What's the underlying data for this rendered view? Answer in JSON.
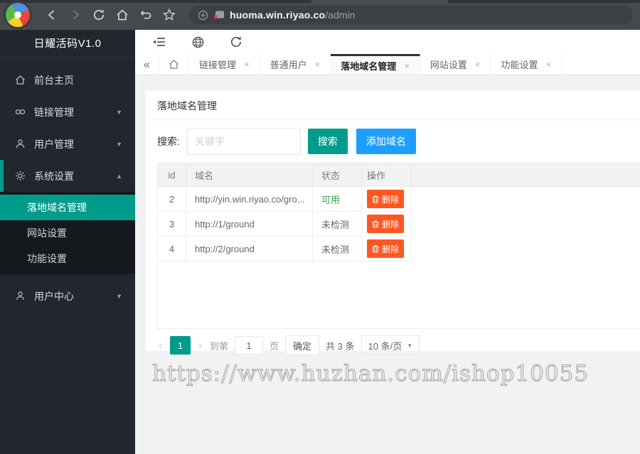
{
  "browser": {
    "url_domain": "huoma.win.riyao.co",
    "url_path": "/admin"
  },
  "sidebar": {
    "title": "日耀活码V1.0",
    "items": [
      {
        "label": "前台主页",
        "icon": "home-icon",
        "chevron": ""
      },
      {
        "label": "链接管理",
        "icon": "link-icon",
        "chevron": "▼"
      },
      {
        "label": "用户管理",
        "icon": "user-icon",
        "chevron": "▼"
      },
      {
        "label": "系统设置",
        "icon": "gear-icon",
        "chevron": "▲"
      },
      {
        "label": "用户中心",
        "icon": "person-icon",
        "chevron": "▼"
      }
    ],
    "submenu": [
      {
        "label": "落地域名管理",
        "active": true
      },
      {
        "label": "网站设置",
        "active": false
      },
      {
        "label": "功能设置",
        "active": false
      }
    ]
  },
  "tabbar": {
    "collapse_label": "«",
    "close_glyph": "×",
    "items": [
      {
        "label": "链接管理"
      },
      {
        "label": "普通用户"
      },
      {
        "label": "落地域名管理",
        "active": true
      },
      {
        "label": "网站设置"
      },
      {
        "label": "功能设置"
      }
    ]
  },
  "page": {
    "title": "落地域名管理",
    "search_label": "搜索:",
    "search_placeholder": "关键字",
    "search_button": "搜索",
    "add_domain_button": "添加域名"
  },
  "table": {
    "headers": [
      "id",
      "域名",
      "状态",
      "操作"
    ],
    "rows": [
      {
        "id": "2",
        "domain": "http://yin.win.riyao.co/gro...",
        "status": "可用",
        "action": "删除"
      },
      {
        "id": "3",
        "domain": "http://1/ground",
        "status": "未检测",
        "action": "删除"
      },
      {
        "id": "4",
        "domain": "http://2/ground",
        "status": "未检测",
        "action": "删除"
      }
    ]
  },
  "pagination": {
    "prev": "‹",
    "current_page": "1",
    "next": "›",
    "goto_label": "到第",
    "goto_value": "1",
    "page_unit": "页",
    "confirm": "确定",
    "total": "共 3 条",
    "per_page": "10 条/页",
    "dropdown_arrow": "▼"
  },
  "watermark": "https://www.huzhan.com/ishop10055",
  "colors": {
    "accent_teal": "#009c8b",
    "add_button_blue": "#1e9fff",
    "delete_orange": "#ff5722",
    "status_ok_green": "#36a44f",
    "sidebar_bg": "#22262d",
    "submenu_bg": "#15181d",
    "browser_bar": "#46494e",
    "main_bg": "#f2f2f2"
  }
}
